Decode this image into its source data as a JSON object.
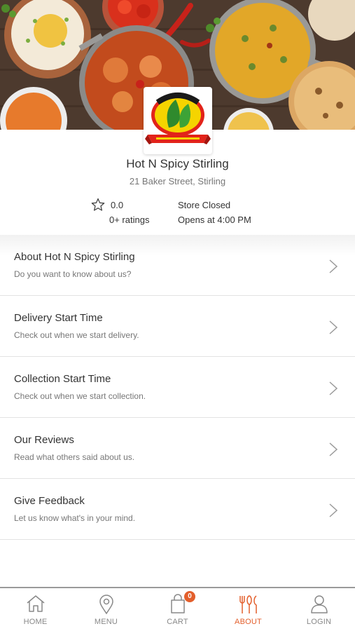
{
  "store": {
    "name": "Hot N Spicy Stirling",
    "address": "21 Baker Street, Stirling",
    "rating_value": "0.0",
    "rating_count": "0+ ratings",
    "status": "Store Closed",
    "opens_at": "Opens at 4:00 PM",
    "logo_text": "HOT 'N' SPICY",
    "logo_banner": "INDIAN TANDOORI TAKEAWAY"
  },
  "menu": [
    {
      "title": "About Hot N Spicy Stirling",
      "subtitle": "Do you want to know about us?"
    },
    {
      "title": "Delivery Start Time",
      "subtitle": "Check out when we start delivery."
    },
    {
      "title": "Collection Start Time",
      "subtitle": "Check out when we start collection."
    },
    {
      "title": "Our Reviews",
      "subtitle": "Read what others said about us."
    },
    {
      "title": "Give Feedback",
      "subtitle": "Let us know what's in your mind."
    }
  ],
  "nav": {
    "home": "HOME",
    "menu": "MENU",
    "cart": "CART",
    "cart_count": "0",
    "about": "ABOUT",
    "login": "LOGIN",
    "active": "about"
  },
  "colors": {
    "accent": "#e35f2c",
    "text": "#333333",
    "muted": "#777777",
    "divider": "#e3e3e3"
  },
  "icons": [
    "food-banner-image",
    "restaurant-logo",
    "star-icon",
    "chevron-right-icon",
    "home-icon",
    "location-pin-icon",
    "cart-icon",
    "cutlery-icon",
    "user-icon"
  ]
}
